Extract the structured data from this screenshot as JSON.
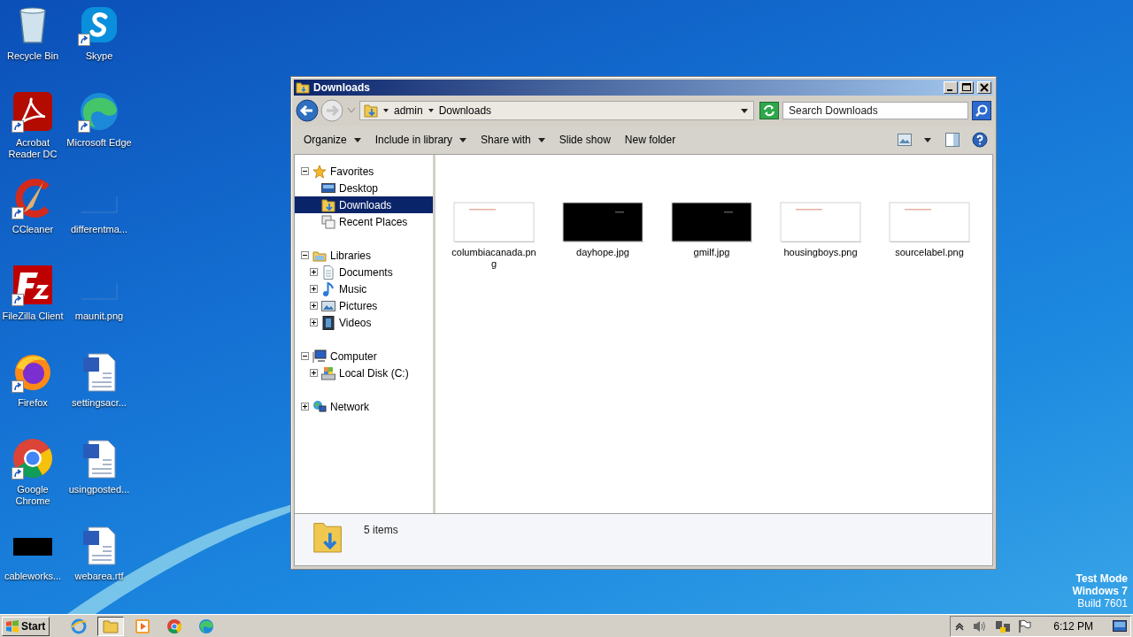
{
  "desktop": {
    "icons": [
      {
        "label": "Recycle Bin",
        "kind": "recycle",
        "shortcut": false
      },
      {
        "label": "Acrobat Reader DC",
        "kind": "acrobat",
        "shortcut": true
      },
      {
        "label": "CCleaner",
        "kind": "ccleaner",
        "shortcut": true
      },
      {
        "label": "FileZilla Client",
        "kind": "filezilla",
        "shortcut": true
      },
      {
        "label": "Firefox",
        "kind": "firefox",
        "shortcut": true
      },
      {
        "label": "Google Chrome",
        "kind": "chrome",
        "shortcut": true
      },
      {
        "label": "cableworks...",
        "kind": "dark",
        "shortcut": false
      },
      {
        "label": "Skype",
        "kind": "skype",
        "shortcut": true
      },
      {
        "label": "Microsoft Edge",
        "kind": "edge",
        "shortcut": true
      },
      {
        "label": "differentma...",
        "kind": "blank",
        "shortcut": false
      },
      {
        "label": "maunit.png",
        "kind": "blank",
        "shortcut": false
      },
      {
        "label": "settingsacr...",
        "kind": "word",
        "shortcut": false
      },
      {
        "label": "usingposted...",
        "kind": "word",
        "shortcut": false
      },
      {
        "label": "webarea.rtf",
        "kind": "word",
        "shortcut": false
      }
    ],
    "notice": [
      "Test Mode",
      "Windows 7",
      "Build 7601"
    ]
  },
  "window": {
    "title": "Downloads",
    "address": {
      "segments": [
        "admin",
        "Downloads"
      ]
    },
    "search": {
      "placeholder": "Search Downloads"
    },
    "toolbar": [
      {
        "label": "Organize",
        "dropdown": true
      },
      {
        "label": "Include in library",
        "dropdown": true
      },
      {
        "label": "Share with",
        "dropdown": true
      },
      {
        "label": "Slide show",
        "dropdown": false
      },
      {
        "label": "New folder",
        "dropdown": false
      }
    ],
    "nav": [
      {
        "label": "Favorites",
        "kind": "star",
        "expanded": true,
        "children": [
          {
            "label": "Desktop",
            "kind": "desktop",
            "selected": false
          },
          {
            "label": "Downloads",
            "kind": "downloads",
            "selected": true
          },
          {
            "label": "Recent Places",
            "kind": "recent",
            "selected": false
          }
        ]
      },
      {
        "label": "Libraries",
        "kind": "library",
        "expanded": true,
        "children": [
          {
            "label": "Documents",
            "kind": "documents",
            "selected": false,
            "expanded": false
          },
          {
            "label": "Music",
            "kind": "music",
            "selected": false,
            "expanded": false
          },
          {
            "label": "Pictures",
            "kind": "pictures",
            "selected": false,
            "expanded": false
          },
          {
            "label": "Videos",
            "kind": "videos",
            "selected": false,
            "expanded": false
          }
        ]
      },
      {
        "label": "Computer",
        "kind": "computer",
        "expanded": true,
        "children": [
          {
            "label": "Local Disk (C:)",
            "kind": "disk",
            "selected": false,
            "expanded": false
          }
        ]
      },
      {
        "label": "Network",
        "kind": "network",
        "expanded": false
      }
    ],
    "files": [
      {
        "name": "columbiacanada.png",
        "kind": "light"
      },
      {
        "name": "dayhope.jpg",
        "kind": "dark"
      },
      {
        "name": "gmilf.jpg",
        "kind": "dark"
      },
      {
        "name": "housingboys.png",
        "kind": "light"
      },
      {
        "name": "sourcelabel.png",
        "kind": "light"
      }
    ],
    "status": "5 items"
  },
  "taskbar": {
    "start": "Start",
    "apps": [
      {
        "kind": "ie",
        "selected": false
      },
      {
        "kind": "explorer",
        "selected": true
      },
      {
        "kind": "media",
        "selected": false
      },
      {
        "kind": "chrome",
        "selected": false
      },
      {
        "kind": "edge",
        "selected": false
      }
    ],
    "clock": "6:12 PM"
  }
}
